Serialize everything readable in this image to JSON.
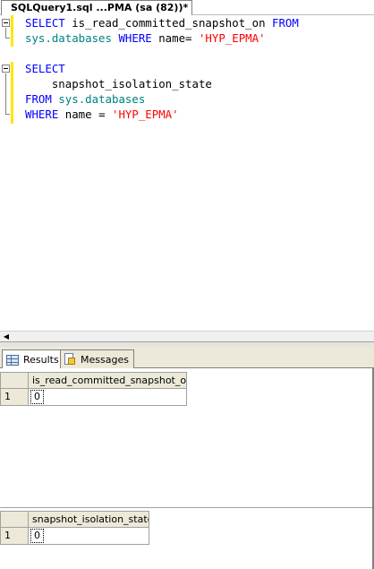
{
  "document_tab": {
    "title": "SQLQuery1.sql ...PMA (sa (82))*"
  },
  "editor": {
    "lines": [
      [
        {
          "t": "SELECT ",
          "c": "kw"
        },
        {
          "t": "is_read_committed_snapshot_on ",
          "c": "plain"
        },
        {
          "t": "FROM",
          "c": "kw"
        }
      ],
      [
        {
          "t": "sys.databases ",
          "c": "obj"
        },
        {
          "t": "WHERE ",
          "c": "kw"
        },
        {
          "t": "name= ",
          "c": "plain"
        },
        {
          "t": "'HYP_EPMA'",
          "c": "str"
        }
      ],
      [],
      [
        {
          "t": "SELECT",
          "c": "kw"
        }
      ],
      [
        {
          "t": "    snapshot_isolation_state",
          "c": "plain"
        }
      ],
      [
        {
          "t": "FROM ",
          "c": "kw"
        },
        {
          "t": "sys.databases",
          "c": "obj"
        }
      ],
      [
        {
          "t": "WHERE ",
          "c": "kw"
        },
        {
          "t": "name = ",
          "c": "plain"
        },
        {
          "t": "'HYP_EPMA'",
          "c": "str"
        }
      ]
    ]
  },
  "results_tabs": {
    "results_label": "Results",
    "messages_label": "Messages"
  },
  "result_grids": [
    {
      "column": "is_read_committed_snapshot_on",
      "row_number": "1",
      "value": "0"
    },
    {
      "column": "snapshot_isolation_state",
      "row_number": "1",
      "value": "0"
    }
  ],
  "colors": {
    "keyword": "#0000ff",
    "object": "#008080",
    "string": "#ff0000",
    "change_marker": "#ffe600"
  },
  "icons": {
    "results_tab": "grid-icon",
    "messages_tab": "message-icon",
    "collapse": "minus-box-icon",
    "scroll_left": "left-arrow-icon"
  }
}
